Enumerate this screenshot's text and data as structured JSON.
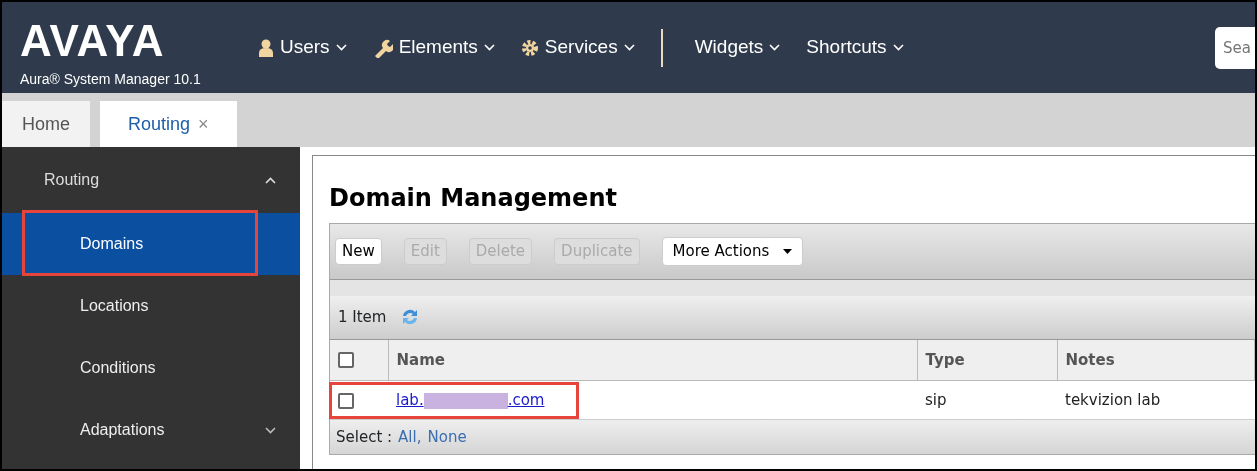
{
  "header": {
    "logo": "AVAYA",
    "product": "Aura® System Manager 10.1",
    "menus": [
      {
        "label": "Users"
      },
      {
        "label": "Elements"
      },
      {
        "label": "Services"
      },
      {
        "label": "Widgets"
      },
      {
        "label": "Shortcuts"
      }
    ],
    "search": {
      "placeholder": "Sea"
    }
  },
  "tabs": [
    {
      "label": "Home",
      "selected": false,
      "closable": false
    },
    {
      "label": "Routing",
      "selected": true,
      "closable": true,
      "close": "×"
    }
  ],
  "sidebar": {
    "title": "Routing",
    "expanded": true,
    "items": [
      {
        "label": "Domains",
        "selected": true,
        "highlighted": true,
        "expandable": false
      },
      {
        "label": "Locations",
        "selected": false,
        "highlighted": false,
        "expandable": false
      },
      {
        "label": "Conditions",
        "selected": false,
        "highlighted": false,
        "expandable": false
      },
      {
        "label": "Adaptations",
        "selected": false,
        "highlighted": false,
        "expandable": true
      }
    ]
  },
  "page": {
    "title": "Domain Management",
    "toolbar": [
      {
        "label": "New",
        "disabled": false,
        "kind": "button"
      },
      {
        "label": "Edit",
        "disabled": true,
        "kind": "button"
      },
      {
        "label": "Delete",
        "disabled": true,
        "kind": "button"
      },
      {
        "label": "Duplicate",
        "disabled": true,
        "kind": "button"
      },
      {
        "label": "More Actions",
        "disabled": false,
        "kind": "dropdown"
      }
    ],
    "count": "1 Item",
    "table": {
      "columns": [
        "Name",
        "Type",
        "Notes"
      ],
      "header_checked": false,
      "rows": [
        {
          "checked": false,
          "highlighted": true,
          "name_prefix": "lab.",
          "redacted": true,
          "name_suffix": ".com",
          "type": "sip",
          "notes": "tekvizion lab"
        }
      ]
    },
    "footer": {
      "label": "Select :",
      "links": [
        "All,",
        "None"
      ]
    }
  }
}
